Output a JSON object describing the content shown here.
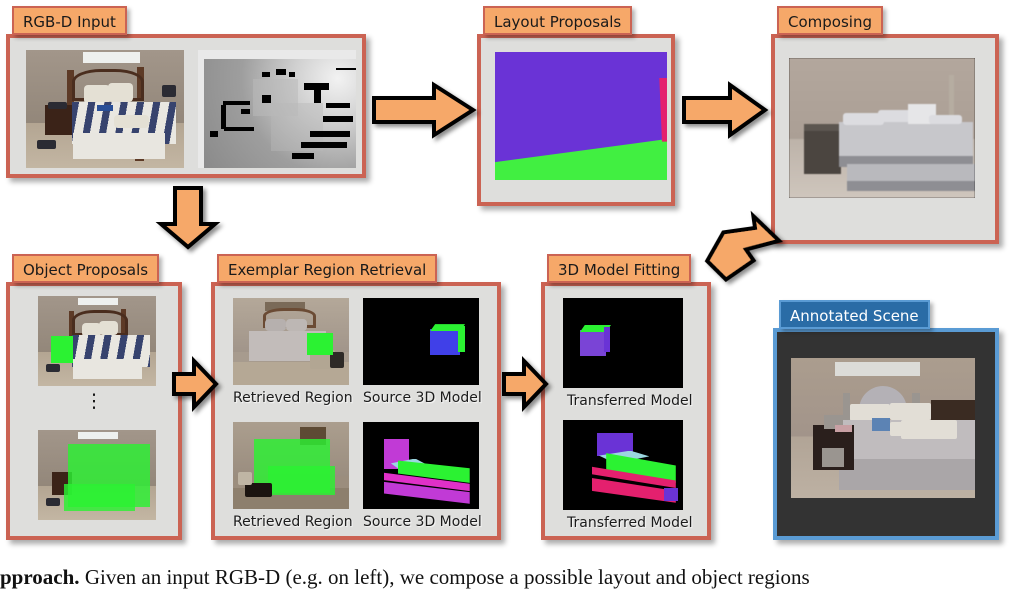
{
  "figure": {
    "type": "pipeline-diagram",
    "panels": [
      {
        "id": "rgbd-input",
        "title": "RGB-D Input",
        "accent": "#cb6353",
        "header_bg": "#f6a869"
      },
      {
        "id": "layout-proposals",
        "title": "Layout Proposals",
        "accent": "#cb6353",
        "header_bg": "#f6a869"
      },
      {
        "id": "composing",
        "title": "Composing",
        "accent": "#cb6353",
        "header_bg": "#f6a869"
      },
      {
        "id": "object-proposals",
        "title": "Object Proposals",
        "accent": "#cb6353",
        "header_bg": "#f6a869"
      },
      {
        "id": "exemplar-region-retrieval",
        "title": "Exemplar Region Retrieval",
        "accent": "#cb6353",
        "header_bg": "#f6a869"
      },
      {
        "id": "model-fitting",
        "title": "3D Model Fitting",
        "accent": "#cb6353",
        "header_bg": "#f6a869"
      },
      {
        "id": "annotated-scene",
        "title": "Annotated Scene",
        "accent": "#5a9bd4",
        "header_bg": "#2a6ca6"
      }
    ]
  },
  "rgbd": {
    "title": "RGB-D Input",
    "left_image_alt": "color photograph of bedroom with striped bedding",
    "right_image_alt": "grayscale depth map of the same bedroom"
  },
  "layout": {
    "title": "Layout Proposals",
    "regions": [
      {
        "name": "wall",
        "color": "#6a33d6"
      },
      {
        "name": "floor",
        "color": "#41ef41"
      },
      {
        "name": "side-wall",
        "color": "#e4206e"
      }
    ]
  },
  "composing": {
    "title": "Composing",
    "image_alt": "untextured grey 3D render of composed bedroom scene"
  },
  "object_proposals": {
    "title": "Object Proposals",
    "ellipsis": "⋮",
    "items": [
      {
        "name": "proposal-nightstand",
        "image_alt": "bedroom photo with nightstand highlighted green"
      },
      {
        "name": "proposal-bed",
        "image_alt": "bedroom photo with bed highlighted green"
      }
    ]
  },
  "exemplar": {
    "title": "Exemplar Region Retrieval",
    "rows": [
      {
        "left_caption": "Retrieved Region",
        "right_caption": "Source 3D Model",
        "left_alt": "retrieved bedroom image with nightstand region in green",
        "right_alt": "blue and green 3D nightstand model on black"
      },
      {
        "left_caption": "Retrieved Region",
        "right_caption": "Source 3D Model",
        "left_alt": "retrieved bedroom image with bed region in green",
        "right_alt": "magenta and green 3D bed model on black"
      }
    ]
  },
  "fitting": {
    "title": "3D Model Fitting",
    "items": [
      {
        "caption": "Transferred Model",
        "image_alt": "purple and green fitted nightstand model"
      },
      {
        "caption": "Transferred Model",
        "image_alt": "purple, pink and green fitted bed model"
      }
    ]
  },
  "annotated": {
    "title": "Annotated Scene",
    "image_alt": "rendered annotated bedroom scene with bed, nightstand and objects"
  },
  "arrows": [
    {
      "name": "arrow-input-to-layout",
      "direction": "right",
      "color": "#f6a869"
    },
    {
      "name": "arrow-layout-to-composing",
      "direction": "right",
      "color": "#f6a869"
    },
    {
      "name": "arrow-input-to-objects",
      "direction": "down",
      "color": "#f6a869"
    },
    {
      "name": "arrow-objects-to-exemplar",
      "direction": "right",
      "color": "#f6a869"
    },
    {
      "name": "arrow-exemplar-to-fitting",
      "direction": "right",
      "color": "#f6a869"
    },
    {
      "name": "arrow-fitting-to-composing",
      "direction": "up-right",
      "color": "#f6a869"
    }
  ],
  "caption": {
    "lead": "pproach.",
    "rest": "Given an input RGB-D (e.g. on left), we compose a possible layout and object regions"
  }
}
